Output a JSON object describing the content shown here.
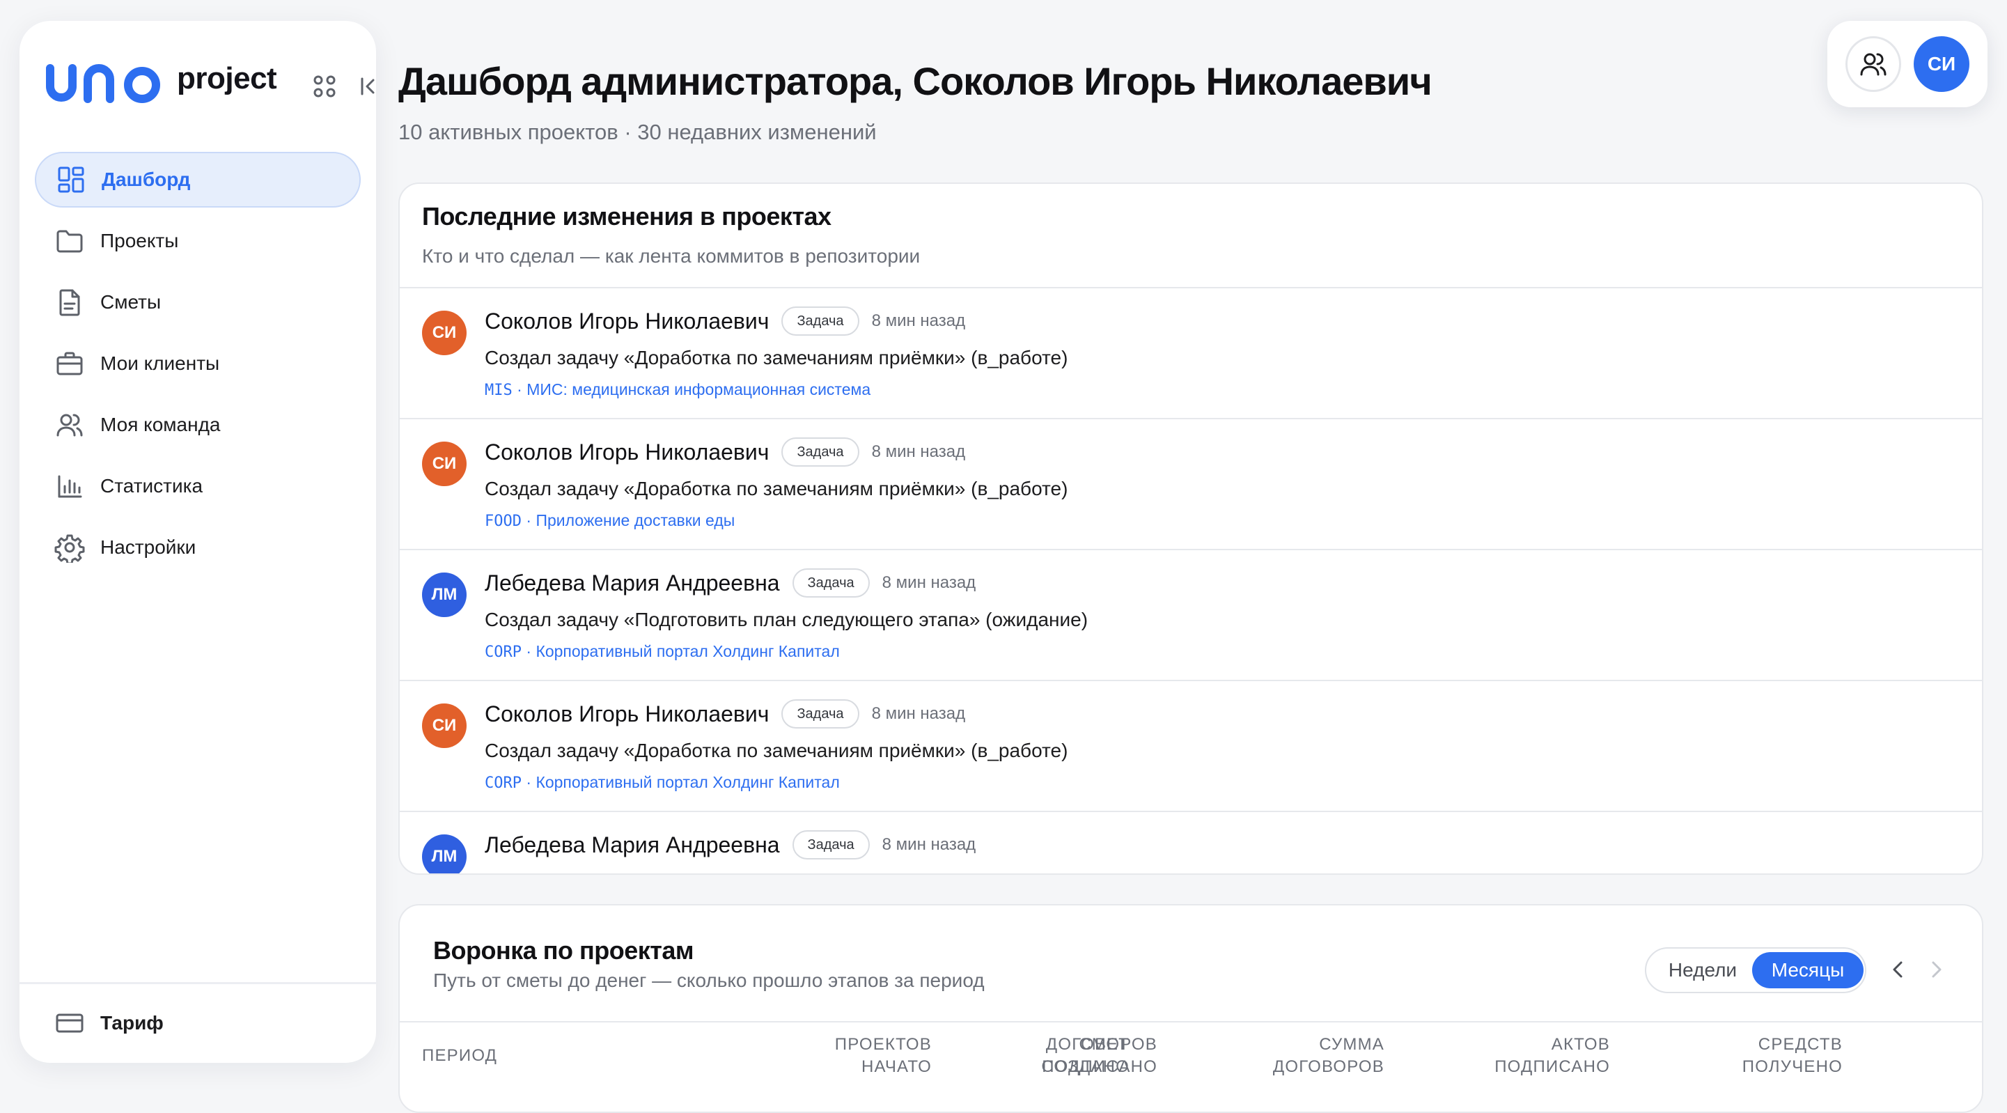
{
  "brand": {
    "logo_text": "uno",
    "product": "project",
    "logo_color": "#2d6ef0"
  },
  "sidebar": {
    "items": [
      {
        "label": "Дашборд",
        "icon": "dashboard-icon",
        "active": true
      },
      {
        "label": "Проекты",
        "icon": "folder-icon"
      },
      {
        "label": "Сметы",
        "icon": "document-icon"
      },
      {
        "label": "Мои клиенты",
        "icon": "briefcase-icon"
      },
      {
        "label": "Моя команда",
        "icon": "team-icon"
      },
      {
        "label": "Статистика",
        "icon": "bar-chart-icon"
      },
      {
        "label": "Настройки",
        "icon": "gear-icon"
      }
    ],
    "bottom": {
      "label": "Тариф",
      "icon": "card-icon"
    }
  },
  "header": {
    "title": "Дашборд администратора, Соколов Игорь Николаевич",
    "subtitle": "10 активных проектов · 30 недавних изменений",
    "user_initials": "СИ"
  },
  "changes": {
    "title": "Последние изменения в проектах",
    "subtitle": "Кто и что сделал — как лента коммитов в репозитории",
    "items": [
      {
        "initials": "СИ",
        "name": "Соколов Игорь Николаевич",
        "tag": "Задача",
        "time": "8 мин назад",
        "desc": "Создал задачу «Доработка по замечаниям приёмки» (в_работе)",
        "project_code": "MIS",
        "project_name": "МИС: медицинская информационная система",
        "color": "#e2602a"
      },
      {
        "initials": "СИ",
        "name": "Соколов Игорь Николаевич",
        "tag": "Задача",
        "time": "8 мин назад",
        "desc": "Создал задачу «Доработка по замечаниям приёмки» (в_работе)",
        "project_code": "FOOD",
        "project_name": "Приложение доставки еды",
        "color": "#e2602a"
      },
      {
        "initials": "ЛМ",
        "name": "Лебедева Мария Андреевна",
        "tag": "Задача",
        "time": "8 мин назад",
        "desc": "Создал задачу «Подготовить план следующего этапа» (ожидание)",
        "project_code": "CORP",
        "project_name": "Корпоративный портал Холдинг Капитал",
        "color": "#2f5fe0"
      },
      {
        "initials": "СИ",
        "name": "Соколов Игорь Николаевич",
        "tag": "Задача",
        "time": "8 мин назад",
        "desc": "Создал задачу «Доработка по замечаниям приёмки» (в_работе)",
        "project_code": "CORP",
        "project_name": "Корпоративный портал Холдинг Капитал",
        "color": "#e2602a"
      },
      {
        "initials": "ЛМ",
        "name": "Лебедева Мария Андреевна",
        "tag": "Задача",
        "time": "8 мин назад",
        "desc": "",
        "project_code": "",
        "project_name": "",
        "color": "#2f5fe0"
      }
    ]
  },
  "funnel": {
    "title": "Воронка по проектам",
    "subtitle": "Путь от сметы до денег — сколько прошло этапов за период",
    "toggle": {
      "weeks": "Недели",
      "months": "Месяцы",
      "selected": "Месяцы"
    },
    "columns": [
      [
        "ПЕРИОД"
      ],
      [
        "СМЕТ",
        "СОЗДАНО"
      ],
      [
        "ПРОЕКТОВ",
        "НАЧАТО"
      ],
      [
        "ДОГОВОРОВ",
        "ПОДПИСАНО"
      ],
      [
        "СУММА",
        "ДОГОВОРОВ"
      ],
      [
        "АКТОВ",
        "ПОДПИСАНО"
      ],
      [
        "СРЕДСТВ",
        "ПОЛУЧЕНО"
      ]
    ]
  }
}
